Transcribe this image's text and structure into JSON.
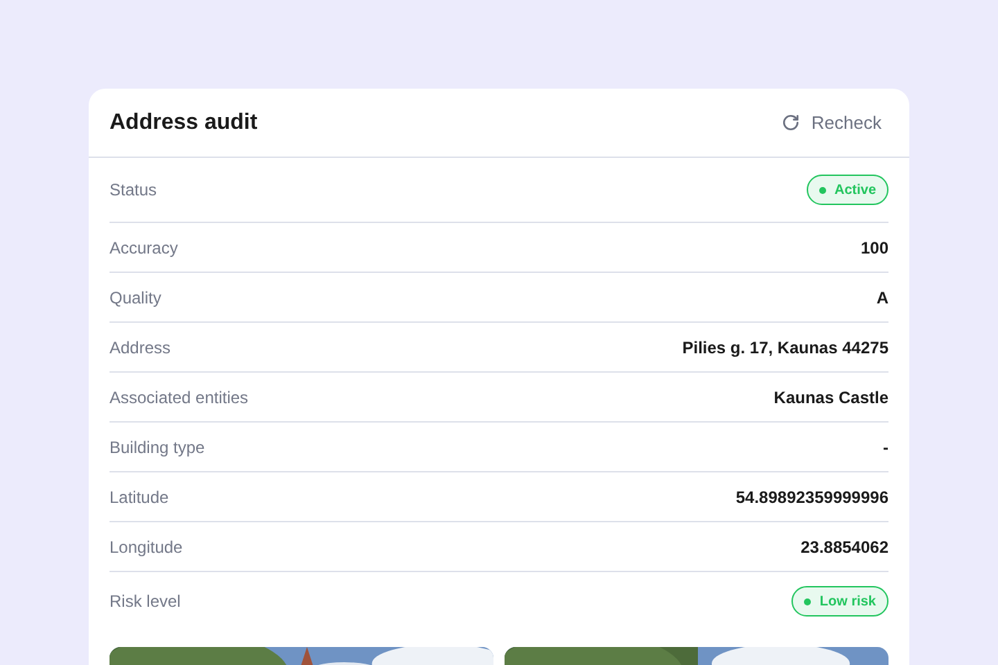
{
  "card": {
    "title": "Address audit",
    "action": "Recheck"
  },
  "rows": [
    {
      "label": "Status",
      "kind": "badge",
      "value": "Active",
      "color": "#22c55e"
    },
    {
      "label": "Accuracy",
      "kind": "text",
      "value": "100"
    },
    {
      "label": "Quality",
      "kind": "text",
      "value": "A"
    },
    {
      "label": "Address",
      "kind": "text",
      "value": "Pilies g. 17, Kaunas 44275"
    },
    {
      "label": "Associated entities",
      "kind": "text",
      "value": "Kaunas Castle"
    },
    {
      "label": "Building type",
      "kind": "text",
      "value": "-"
    },
    {
      "label": "Latitude",
      "kind": "text",
      "value": "54.89892359999996"
    },
    {
      "label": "Longitude",
      "kind": "text",
      "value": "23.8854062"
    },
    {
      "label": "Risk level",
      "kind": "badge",
      "value": "Low risk",
      "color": "#22c55e"
    }
  ]
}
